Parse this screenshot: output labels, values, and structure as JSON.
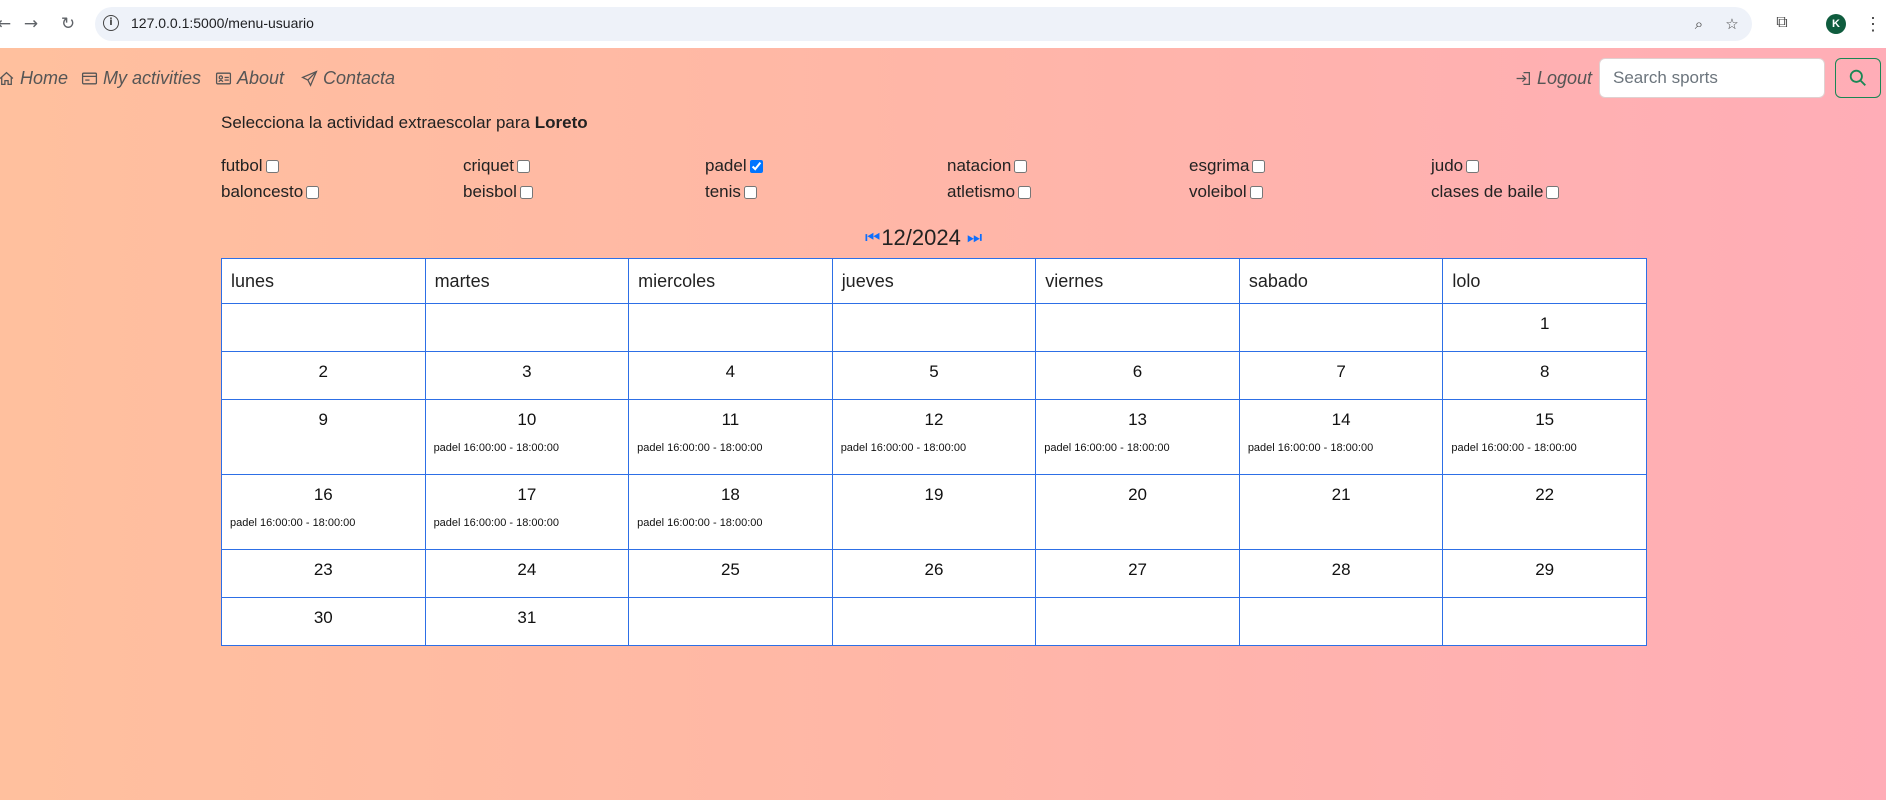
{
  "browser": {
    "url": "127.0.0.1:5000/menu-usuario",
    "avatar_letter": "K"
  },
  "nav": {
    "home": "Home",
    "activities": "My activities",
    "about": "About",
    "contact": "Contacta",
    "logout": "Logout",
    "search_placeholder": "Search sports"
  },
  "intro": {
    "text": "Selecciona la actividad extraescolar para ",
    "name": "Loreto"
  },
  "sports": [
    {
      "label": "futbol",
      "checked": false
    },
    {
      "label": "criquet",
      "checked": false
    },
    {
      "label": "padel",
      "checked": true
    },
    {
      "label": "natacion",
      "checked": false
    },
    {
      "label": "esgrima",
      "checked": false
    },
    {
      "label": "judo",
      "checked": false
    },
    {
      "label": "baloncesto",
      "checked": false
    },
    {
      "label": "beisbol",
      "checked": false
    },
    {
      "label": "tenis",
      "checked": false
    },
    {
      "label": "atletismo",
      "checked": false
    },
    {
      "label": "voleibol",
      "checked": false
    },
    {
      "label": "clases de baile",
      "checked": false
    }
  ],
  "calendar": {
    "month_label": "12/2024",
    "prev_icon": "double-prev-icon",
    "next_icon": "double-next-icon",
    "headers": [
      "lunes",
      "martes",
      "miercoles",
      "jueves",
      "viernes",
      "sabado",
      "lolo"
    ],
    "weeks": [
      [
        {
          "d": ""
        },
        {
          "d": ""
        },
        {
          "d": ""
        },
        {
          "d": ""
        },
        {
          "d": ""
        },
        {
          "d": ""
        },
        {
          "d": "1"
        }
      ],
      [
        {
          "d": "2"
        },
        {
          "d": "3"
        },
        {
          "d": "4"
        },
        {
          "d": "5"
        },
        {
          "d": "6"
        },
        {
          "d": "7"
        },
        {
          "d": "8"
        }
      ],
      [
        {
          "d": "9"
        },
        {
          "d": "10",
          "e": "padel 16:00:00 - 18:00:00"
        },
        {
          "d": "11",
          "e": "padel 16:00:00 - 18:00:00"
        },
        {
          "d": "12",
          "e": "padel 16:00:00 - 18:00:00"
        },
        {
          "d": "13",
          "e": "padel 16:00:00 - 18:00:00"
        },
        {
          "d": "14",
          "e": "padel 16:00:00 - 18:00:00"
        },
        {
          "d": "15",
          "e": "padel 16:00:00 - 18:00:00"
        }
      ],
      [
        {
          "d": "16",
          "e": "padel 16:00:00 - 18:00:00"
        },
        {
          "d": "17",
          "e": "padel 16:00:00 - 18:00:00"
        },
        {
          "d": "18",
          "e": "padel 16:00:00 - 18:00:00"
        },
        {
          "d": "19"
        },
        {
          "d": "20"
        },
        {
          "d": "21"
        },
        {
          "d": "22"
        }
      ],
      [
        {
          "d": "23"
        },
        {
          "d": "24"
        },
        {
          "d": "25"
        },
        {
          "d": "26"
        },
        {
          "d": "27"
        },
        {
          "d": "28"
        },
        {
          "d": "29"
        }
      ],
      [
        {
          "d": "30"
        },
        {
          "d": "31"
        },
        {
          "d": ""
        },
        {
          "d": ""
        },
        {
          "d": ""
        },
        {
          "d": ""
        },
        {
          "d": ""
        }
      ]
    ]
  }
}
